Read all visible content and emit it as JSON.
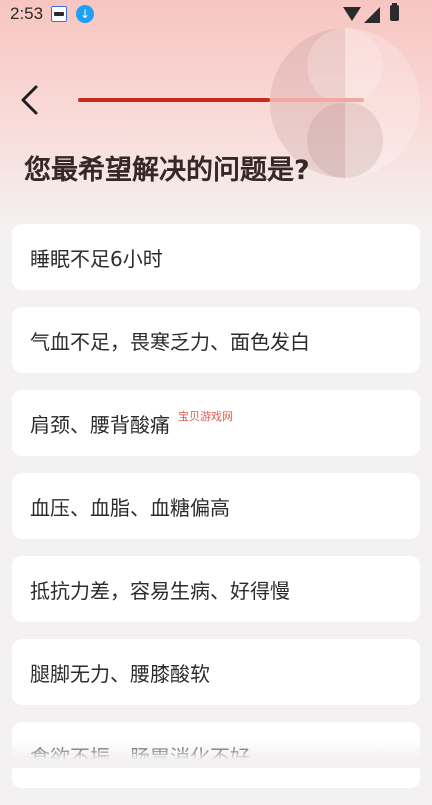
{
  "status_bar": {
    "time": "2:53",
    "icons": [
      "app-notification-icon",
      "download-icon",
      "wifi-icon",
      "signal-icon",
      "battery-icon"
    ]
  },
  "header": {
    "back_icon": "chevron-left-icon",
    "progress_fraction": 0.67,
    "question": "您最希望解决的问题是?"
  },
  "options": [
    "睡眠不足6小时",
    "气血不足，畏寒乏力、面色发白",
    "肩颈、腰背酸痛",
    "血压、血脂、血糖偏高",
    "抵抗力差，容易生病、好得慢",
    "腿脚无力、腰膝酸软",
    "食欲不振、肠胃消化不好"
  ],
  "watermark": "宝贝游戏网",
  "colors": {
    "accent": "#c62c1d",
    "track": "#f0a9a1",
    "header_bg": "#f7c5c1",
    "page_bg": "#f3f1f1"
  }
}
